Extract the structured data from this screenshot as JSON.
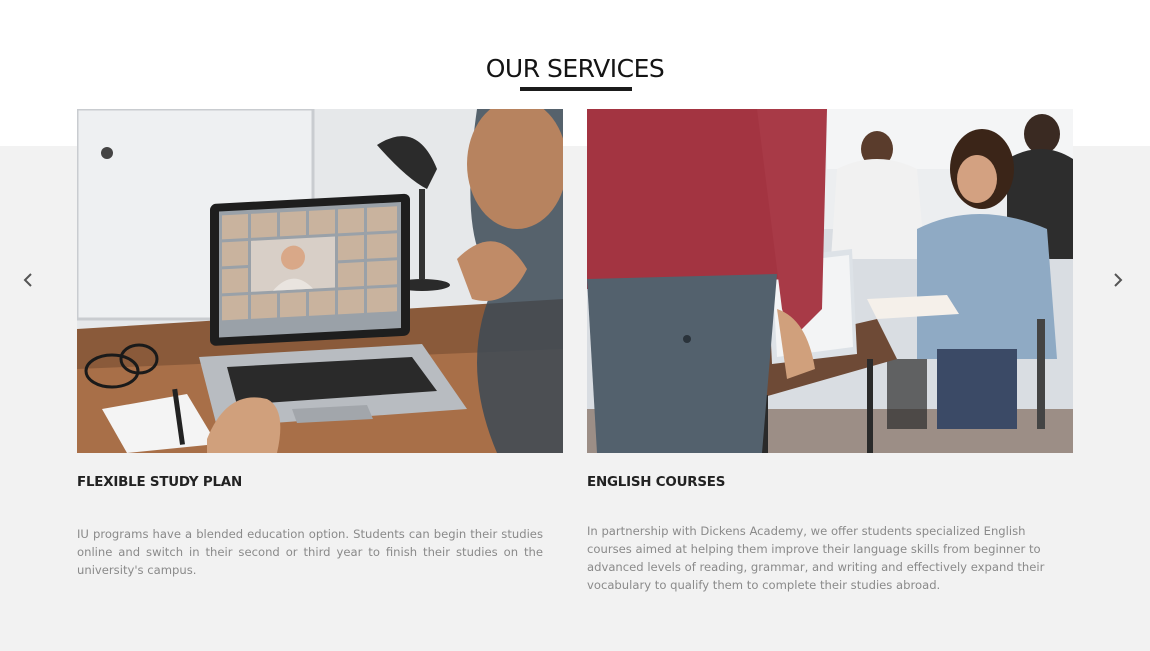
{
  "section": {
    "title": "OUR SERVICES"
  },
  "carousel": {
    "prev_icon": "chevron-left-icon",
    "next_icon": "chevron-right-icon",
    "cards": [
      {
        "title": "FLEXIBLE STUDY PLAN",
        "description": "IU programs have a blended education option. Students can begin their studies online and switch in their second or third year to finish their studies on the university's campus.",
        "image": "photo-person-on-video-call-laptop"
      },
      {
        "title": "ENGLISH COURSES",
        "description": "In partnership with Dickens Academy, we offer students specialized English courses aimed at helping them improve their language skills from beginner to advanced levels of reading, grammar, and writing and effectively expand their vocabulary to qualify them to complete their studies abroad.",
        "image": "photo-classroom-students-writing"
      }
    ]
  },
  "colors": {
    "band": "#f2f2f2",
    "title": "#141414",
    "body_text": "#8a8a8a"
  }
}
